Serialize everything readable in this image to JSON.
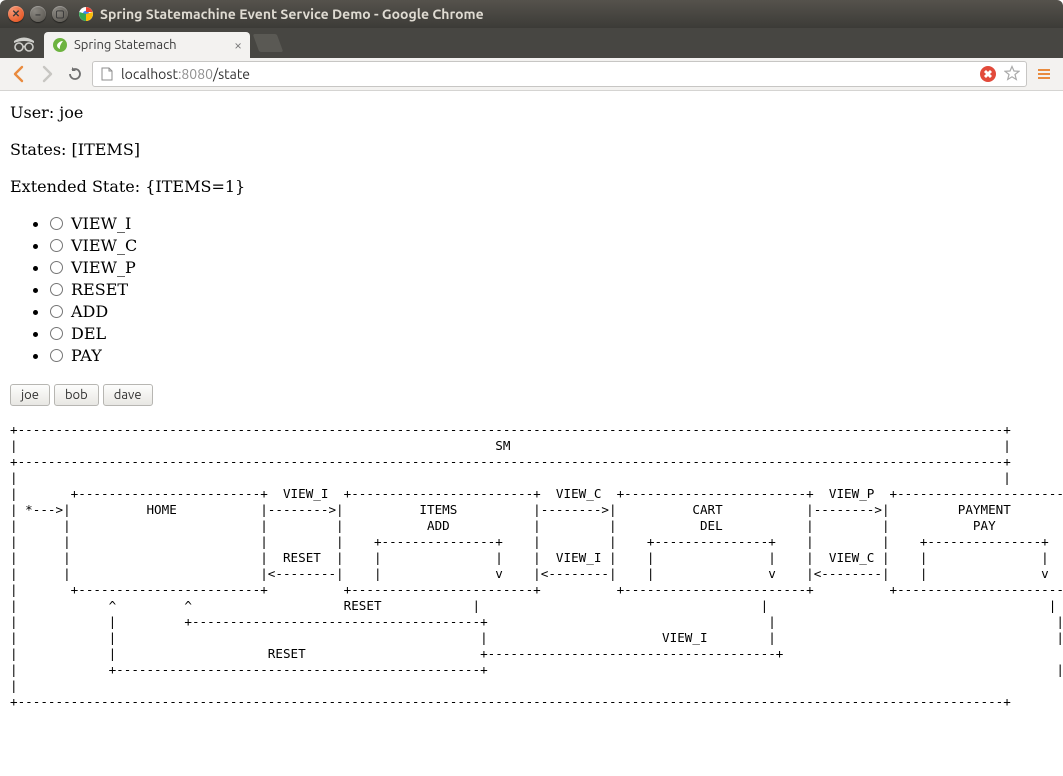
{
  "window": {
    "title": "Spring Statemachine Event Service Demo - Google Chrome"
  },
  "tab": {
    "title": "Spring Statemach"
  },
  "url": {
    "host": "localhost",
    "port": ":8080",
    "path": "/state"
  },
  "page": {
    "user_line": "User: joe",
    "states_line": "States: [ITEMS]",
    "ext_state_line": "Extended State: {ITEMS=1}"
  },
  "events": [
    {
      "label": "VIEW_I"
    },
    {
      "label": "VIEW_C"
    },
    {
      "label": "VIEW_P"
    },
    {
      "label": "RESET"
    },
    {
      "label": "ADD"
    },
    {
      "label": "DEL"
    },
    {
      "label": "PAY"
    }
  ],
  "users": [
    {
      "label": "joe"
    },
    {
      "label": "bob"
    },
    {
      "label": "dave"
    }
  ],
  "ascii_diagram": "+----------------------------------------------------------------------------------------------------------------------------------+\n|                                                               SM                                                                 |\n+----------------------------------------------------------------------------------------------------------------------------------+\n|                                                                                                                                  |\n|       +------------------------+  VIEW_I  +------------------------+  VIEW_C  +------------------------+  VIEW_P  +------------------------+\n| *--->|          HOME           |-------->|          ITEMS          |-------->|          CART           |-------->|         PAYMENT         |\n|      |                         |         |           ADD           |         |           DEL           |         |           PAY           |\n|      |                         |         |    +---------------+    |         |    +---------------+    |         |    +---------------+    |\n|      |                         |  RESET  |    |               |    |  VIEW_I |    |               |    |  VIEW_C |    |               |    |\n|      |                         |<--------|    |               v    |<--------|    |               v    |<--------|    |               v    |\n|       +------------------------+          +------------------------+          +------------------------+          +------------------------+\n|            ^         ^                    RESET            |                                     |                                     |\n|            |         +--------------------------------------+                                     |                                     |\n|            |                                                |                       VIEW_I        |                                     |\n|            |                    RESET                       +--------------------------------------+                                     |\n|            +------------------------------------------------+                                                                           |\n|                                                                                                                                          |\n+----------------------------------------------------------------------------------------------------------------------------------+"
}
